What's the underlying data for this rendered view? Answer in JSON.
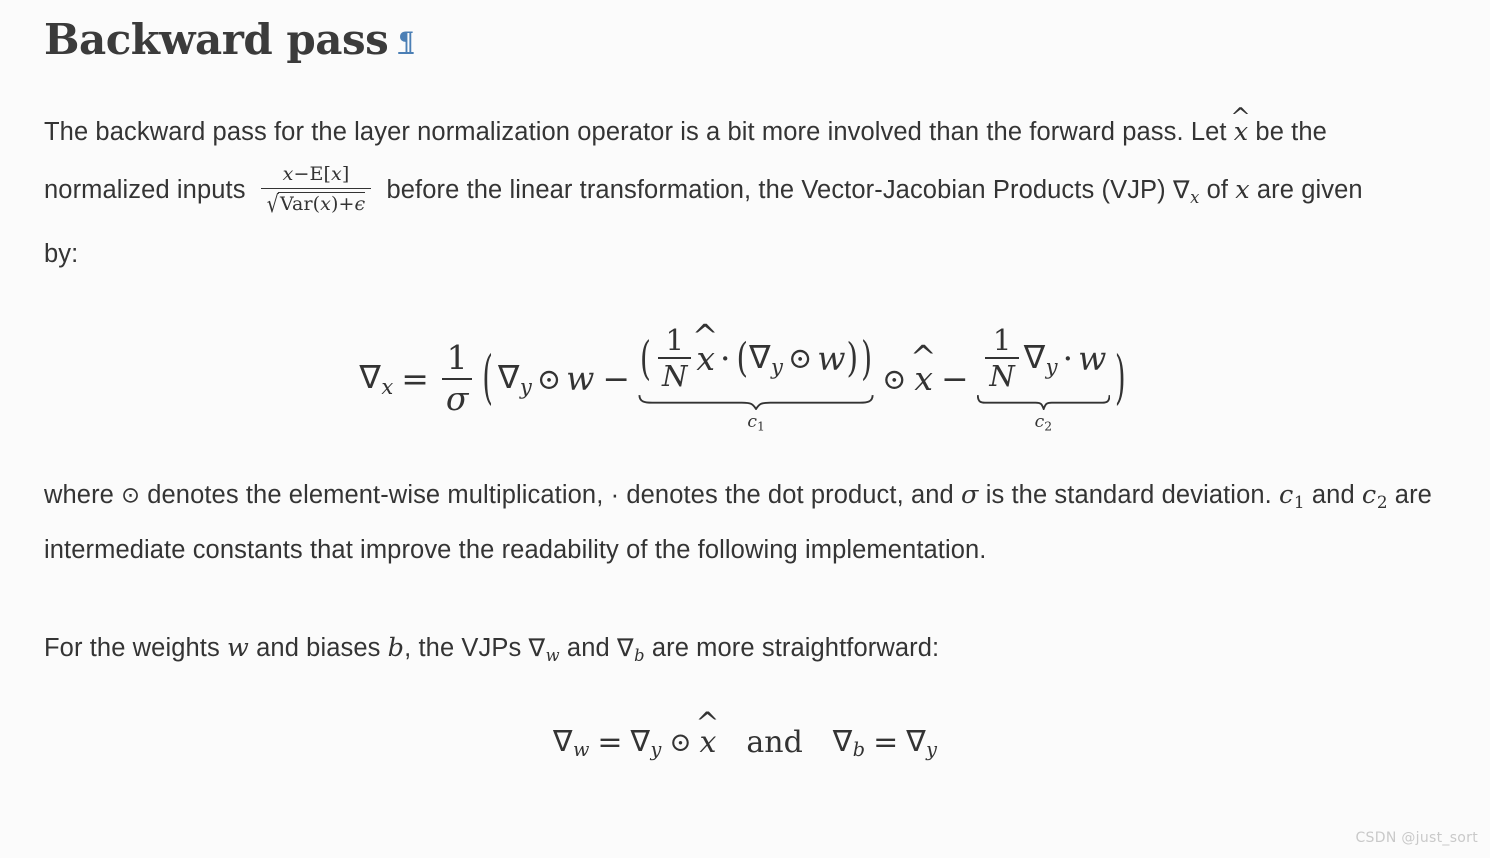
{
  "document": {
    "background_color": "#fbfbfb",
    "text_color": "#343434",
    "accent_color": "#4b7fb5"
  },
  "heading": {
    "title": "Backward pass",
    "anchor_symbol": "¶",
    "anchor_name": "pilcrow-anchor-icon"
  },
  "paragraphs": {
    "intro": {
      "seg1": "The backward pass for the layer normalization operator is a bit more involved than the forward pass. Let ",
      "math_xhat": "x̂",
      "seg2": " be the normalized inputs ",
      "fraction_numerator": "x−E[x]",
      "fraction_denominator_inner": "Var(x)+ϵ",
      "radical_symbol": "√",
      "seg3": " before the linear transformation, the Vector-Jacobian Products (VJP) ",
      "math_nabla": "∇",
      "math_nabla_sub": "x",
      "seg4": " of ",
      "math_x": "x",
      "seg5": " are given by:"
    },
    "where": {
      "seg1": "where ",
      "odot": "⊙",
      "seg2": " denotes the element-wise multiplication, · denotes the dot product, and ",
      "sigma": "σ",
      "seg3": " is the standard deviation. ",
      "c1": "c",
      "c1_sub": "1",
      "seg4": " and ",
      "c2": "c",
      "c2_sub": "2",
      "seg5": " are intermediate constants that improve the readability of the following implementation."
    },
    "weights": {
      "seg1": "For the weights ",
      "w": "w",
      "seg2": " and biases ",
      "b": "b",
      "seg3": ", the VJPs ",
      "nabla_w": "∇",
      "nabla_w_sub": "w",
      "seg4": " and ",
      "nabla_b": "∇",
      "nabla_b_sub": "b",
      "seg5": " are more straightforward:"
    }
  },
  "equations": {
    "main": {
      "latex": "\\nabla_x = \\frac{1}{\\sigma}\\left(\\nabla_y \\odot w - \\underbrace{\\left(\\frac{1}{N}\\hat{x}\\cdot(\\nabla_y \\odot w)\\right)}_{c_1} \\odot \\hat{x} - \\underbrace{\\frac{1}{N}\\nabla_y \\cdot w}_{c_2}\\right)",
      "lhs_nabla": "∇",
      "lhs_sub": "x",
      "equals": "=",
      "one": "1",
      "sigma": "σ",
      "N": "N",
      "nabla": "∇",
      "sub_y": "y",
      "odot": "⊙",
      "w": "w",
      "minus": "−",
      "cdot": "·",
      "xhat": "x̂",
      "brace1_label": "c",
      "brace1_sub": "1",
      "brace2_label": "c",
      "brace2_sub": "2"
    },
    "weights_biases": {
      "latex": "\\nabla_w = \\nabla_y \\odot \\hat{x} \\quad \\text{and} \\quad \\nabla_b = \\nabla_y",
      "nabla": "∇",
      "sub_w": "w",
      "sub_y": "y",
      "sub_b": "b",
      "equals": "=",
      "odot": "⊙",
      "xhat": "x̂",
      "and_word": "and"
    }
  },
  "watermark": {
    "text": "CSDN @just_sort"
  }
}
